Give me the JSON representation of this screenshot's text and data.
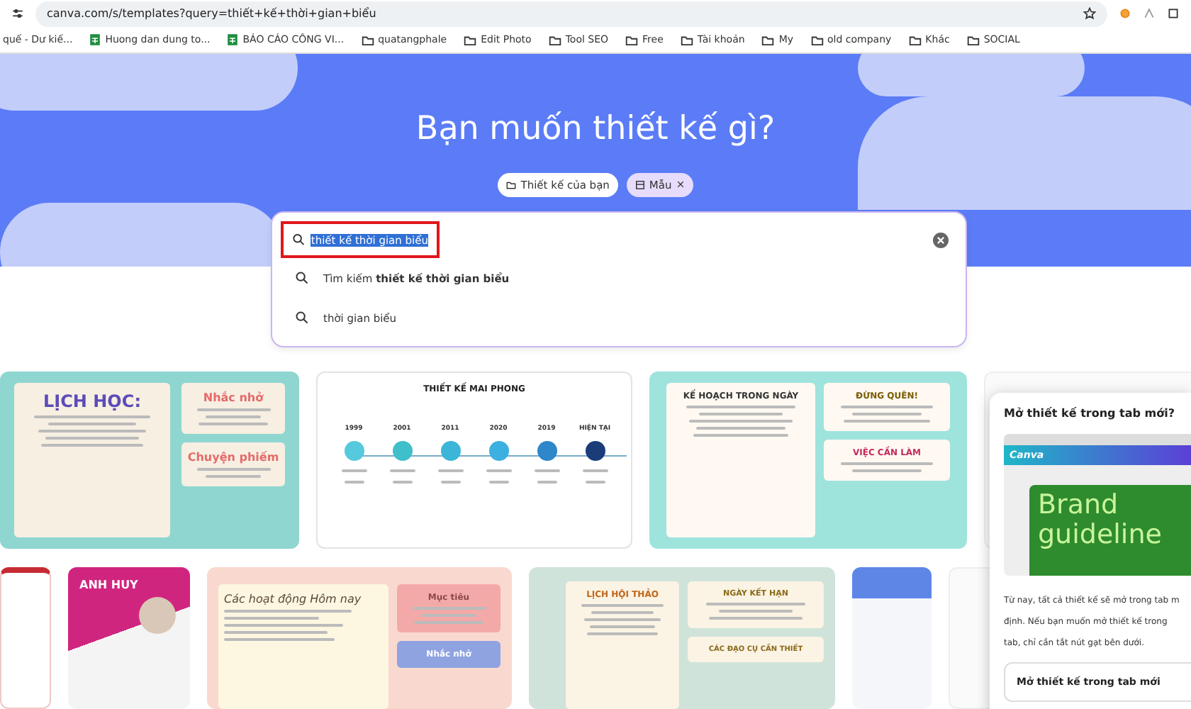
{
  "browser": {
    "url": "canva.com/s/templates?query=thiết+kế+thời+gian+biểu",
    "bookmarks": [
      {
        "kind": "page",
        "label": "quế - Dư kiế..."
      },
      {
        "kind": "sheet",
        "label": "Huong dan dung to..."
      },
      {
        "kind": "sheet",
        "label": "BÁO CÁO CÔNG VI..."
      },
      {
        "kind": "folder",
        "label": "quatangphale"
      },
      {
        "kind": "folder",
        "label": "Edit Photo"
      },
      {
        "kind": "folder",
        "label": "Tool SEO"
      },
      {
        "kind": "folder",
        "label": "Free"
      },
      {
        "kind": "folder",
        "label": "Tài khoản"
      },
      {
        "kind": "folder",
        "label": "My"
      },
      {
        "kind": "folder",
        "label": "old company"
      },
      {
        "kind": "folder",
        "label": "Khác"
      },
      {
        "kind": "folder",
        "label": "SOCIAL"
      }
    ]
  },
  "hero": {
    "title": "Bạn muốn thiết kế gì?",
    "chips": [
      {
        "label": "Thiết kế của bạn",
        "selected": false,
        "removable": false
      },
      {
        "label": "Mẫu",
        "selected": true,
        "removable": true
      }
    ],
    "search": {
      "value": "thiết kế thời gian biểu",
      "highlighted": true
    },
    "suggestions": [
      {
        "text": "Tìm kiếm **thiết kế thời gian biểu**"
      },
      {
        "text": "thời gian biểu"
      }
    ]
  },
  "templates": [
    [
      {
        "kind": "schedule",
        "texts": [
          "LỊCH HỌC:",
          "Nhắc nhở",
          "Chuyện phiếm"
        ]
      },
      {
        "kind": "timeline",
        "texts": [
          "THIẾT KẾ MAI PHONG",
          "1999",
          "2001",
          "2011",
          "2020",
          "2019",
          "HIỆN TẠI"
        ]
      },
      {
        "kind": "planner",
        "texts": [
          "KẾ HOẠCH TRONG NGÀY",
          "ĐỪNG QUÊN!",
          "VIỆC CẦN LÀM"
        ]
      },
      {
        "kind": "blank"
      }
    ],
    [
      {
        "kind": "flowchart"
      },
      {
        "kind": "resume",
        "texts": [
          "ANH HUY"
        ]
      },
      {
        "kind": "notebook",
        "texts": [
          "Các hoạt động Hôm nay",
          "Mục tiêu",
          "Nhắc nhở"
        ]
      },
      {
        "kind": "seminar",
        "texts": [
          "LỊCH HỘI THẢO",
          "NGÀY KẾT HẠN",
          "CÁC ĐẠO CỤ CẦN THIẾT"
        ]
      },
      {
        "kind": "document"
      },
      {
        "kind": "blank"
      }
    ]
  ],
  "popup": {
    "title": "Mở thiết kế trong tab mới?",
    "preview": {
      "logo": "Canva",
      "lines": [
        "Brand",
        "guideline"
      ]
    },
    "body_lines": [
      "Từ nay, tất cả thiết kế sẽ mở trong tab m",
      "định. Nếu bạn muốn mở thiết kế trong",
      "tab, chỉ cần tắt nút gạt bên dưới."
    ],
    "toggle_label": "Mở thiết kế trong tab mới"
  }
}
